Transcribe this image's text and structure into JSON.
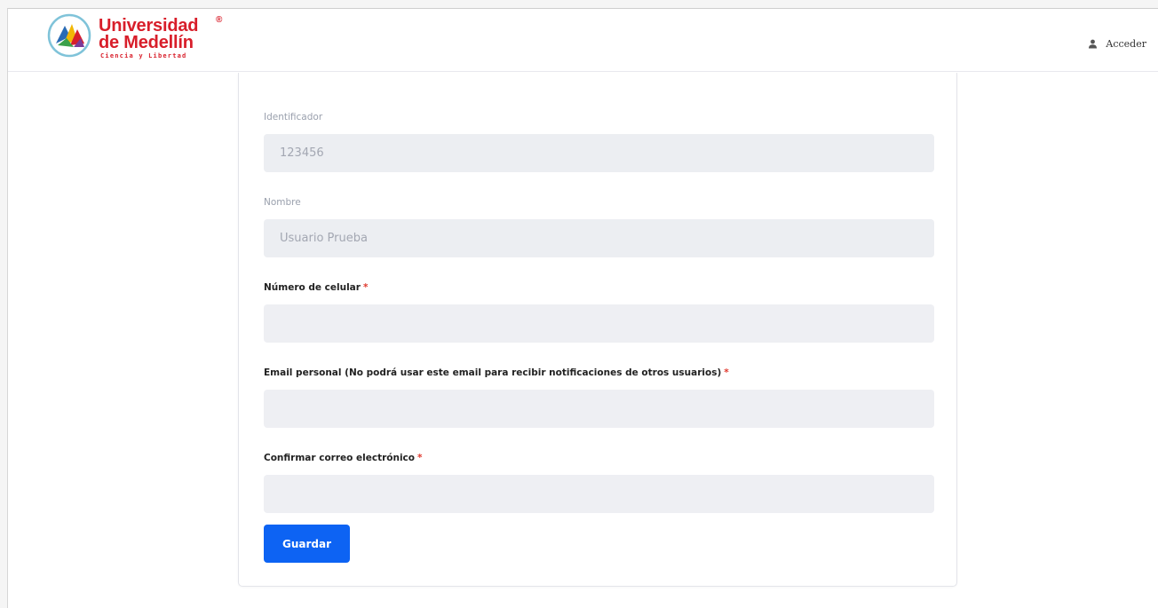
{
  "header": {
    "logo": {
      "line1": "Universidad",
      "registered": "®",
      "line2": "de Medellín",
      "tagline": "Ciencia y Libertad"
    },
    "login_icon": "user-icon",
    "login_label": "Acceder"
  },
  "form": {
    "fields": [
      {
        "label": "Identificador",
        "value": "123456",
        "required": false,
        "disabled": true
      },
      {
        "label": "Nombre",
        "value": "Usuario Prueba",
        "required": false,
        "disabled": true
      },
      {
        "label": "Número de celular",
        "value": "",
        "required": true,
        "disabled": false
      },
      {
        "label": "Email personal (No podrá usar este email para recibir notificaciones de otros usuarios)",
        "value": "",
        "required": true,
        "disabled": false
      },
      {
        "label": "Confirmar correo electrónico",
        "value": "",
        "required": true,
        "disabled": false
      }
    ],
    "required_marker": "*",
    "save_label": "Guardar"
  },
  "colors": {
    "brand_red": "#d81e2a",
    "primary_button": "#0d63f3",
    "input_bg": "#eeeff3",
    "required": "#e0392e"
  }
}
